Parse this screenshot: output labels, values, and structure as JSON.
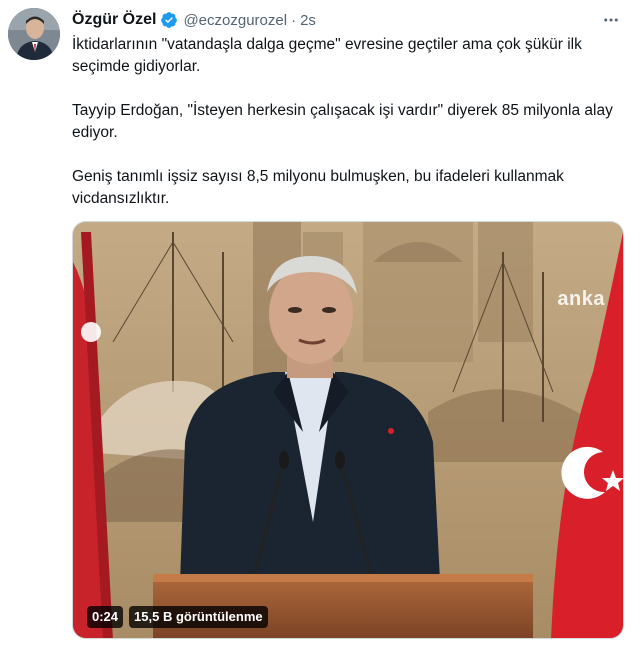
{
  "author": {
    "name": "Özgür Özel",
    "handle": "@eczozgurozel",
    "separator": "·",
    "time": "2s",
    "verified_icon": "verified-badge-icon"
  },
  "tweet": {
    "paragraphs": [
      "İktidarlarının \"vatandaşla dalga geçme\" evresine geçtiler ama çok şükür ilk seçimde gidiyorlar.",
      "Tayyip Erdoğan, \"İsteyen herkesin çalışacak işi vardır\" diyerek 85 milyonla alay ediyor.",
      "Geniş tanımlı işsiz sayısı 8,5 milyonu bulmuşken, bu ifadeleri kullanmak vicdansızlıktır."
    ]
  },
  "media": {
    "watermark": "anka",
    "duration": "0:24",
    "views": "15,5 B görüntülenme"
  },
  "colors": {
    "accent": "#1d9bf0",
    "text": "#0f1419",
    "secondary": "#536471",
    "flag_red": "#d9202a"
  },
  "icons": {
    "more": "more-icon"
  }
}
